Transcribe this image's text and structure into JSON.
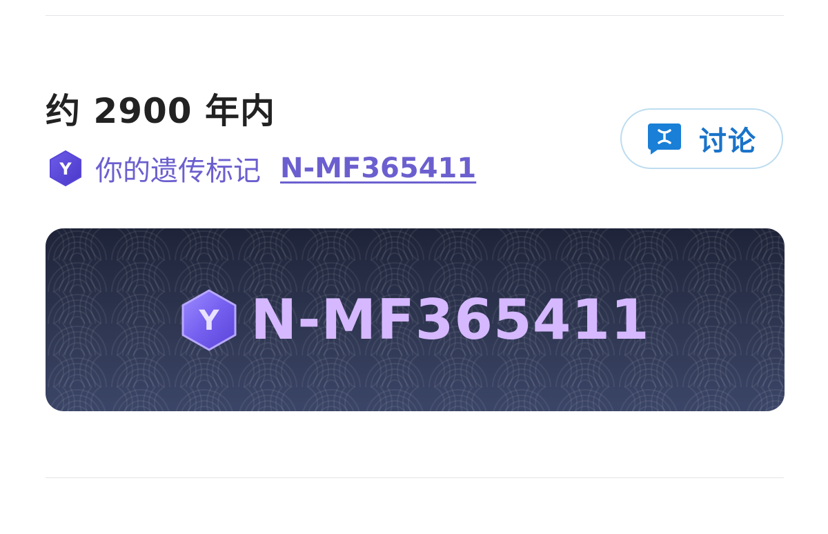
{
  "section": {
    "title": "约 2900 年内"
  },
  "genetic_marker": {
    "badge_letter": "Y",
    "label": "你的遗传标记",
    "code": "N-MF365411"
  },
  "discuss_button": {
    "label": "讨论",
    "icon": "chat-bubble-icon"
  },
  "banner": {
    "badge_letter": "Y",
    "code": "N-MF365411"
  },
  "colors": {
    "accent_purple": "#6b5fcf",
    "discuss_blue": "#1a73c9",
    "banner_text": "#d5b8ff",
    "banner_bg_dark": "#1e2338"
  }
}
